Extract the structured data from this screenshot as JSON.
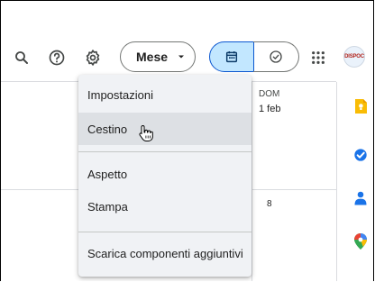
{
  "toolbar": {
    "view_selector": {
      "label": "Mese"
    },
    "icons": [
      "search-icon",
      "help-icon",
      "settings-icon",
      "chevron-down-icon",
      "calendar-icon",
      "tasks-check-icon",
      "apps-grid-icon"
    ],
    "brand_logo": {
      "text": "DISPOC"
    }
  },
  "calendar": {
    "day_header": {
      "weekday": "DOM",
      "date": "1 feb"
    },
    "next_week_date": "8"
  },
  "settings_menu": {
    "items": [
      {
        "label": "Impostazioni"
      },
      {
        "label": "Cestino",
        "hovered": true
      },
      {
        "label": "Aspetto"
      },
      {
        "label": "Stampa"
      },
      {
        "label": "Scarica componenti aggiuntivi"
      }
    ]
  },
  "side_panel": {
    "icons": [
      "keep-icon",
      "tasks-icon",
      "contacts-icon",
      "maps-icon"
    ]
  },
  "colors": {
    "accent": "#0b57d0",
    "selected_segment": "#c2e7ff",
    "menu_background": "#f0f2f5",
    "menu_hover": "#dde0e4"
  }
}
